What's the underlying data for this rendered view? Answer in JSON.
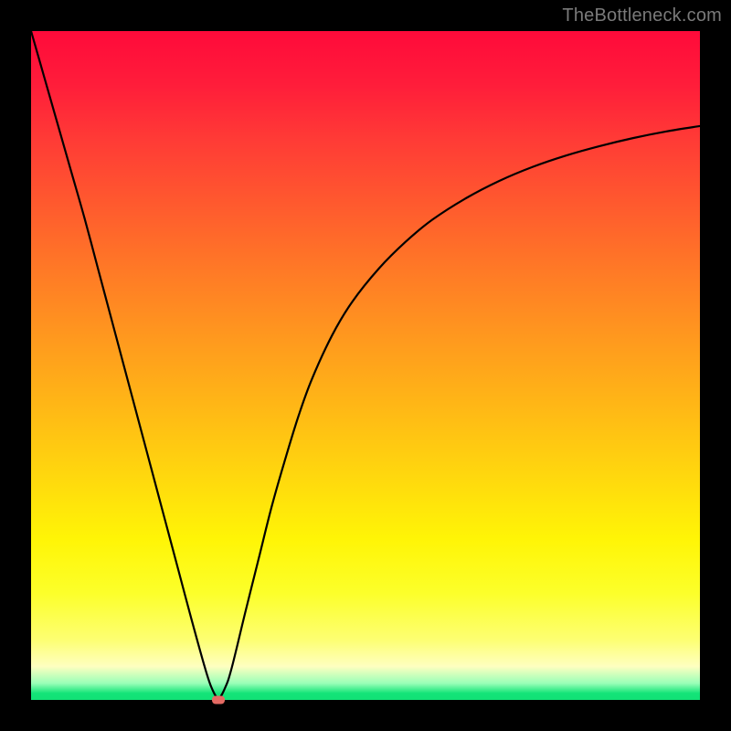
{
  "watermark": "TheBottleneck.com",
  "chart_data": {
    "type": "line",
    "title": "",
    "xlabel": "",
    "ylabel": "",
    "xlim": [
      0,
      100
    ],
    "ylim": [
      0,
      100
    ],
    "grid": false,
    "series": [
      {
        "name": "bottleneck-curve",
        "x": [
          0,
          2,
          4,
          6,
          8,
          10,
          12,
          14,
          16,
          18,
          20,
          22,
          24,
          26,
          27,
          28,
          29,
          30,
          32,
          34,
          36,
          38,
          40,
          42,
          45,
          48,
          52,
          56,
          60,
          65,
          70,
          75,
          80,
          85,
          90,
          95,
          100
        ],
        "y": [
          100,
          93,
          86,
          79,
          72,
          64.5,
          57,
          49.5,
          42,
          34.5,
          27,
          19.5,
          12,
          4.8,
          1.8,
          0.3,
          1.8,
          4.8,
          13,
          21,
          29,
          36,
          42.5,
          48,
          54.5,
          59.5,
          64.5,
          68.5,
          71.8,
          75,
          77.6,
          79.7,
          81.4,
          82.8,
          84,
          85,
          85.8
        ]
      }
    ],
    "marker": {
      "x": 28,
      "y": 0
    },
    "legend": false
  },
  "colors": {
    "curve": "#000000",
    "marker": "#e46a63",
    "frame": "#000000"
  }
}
